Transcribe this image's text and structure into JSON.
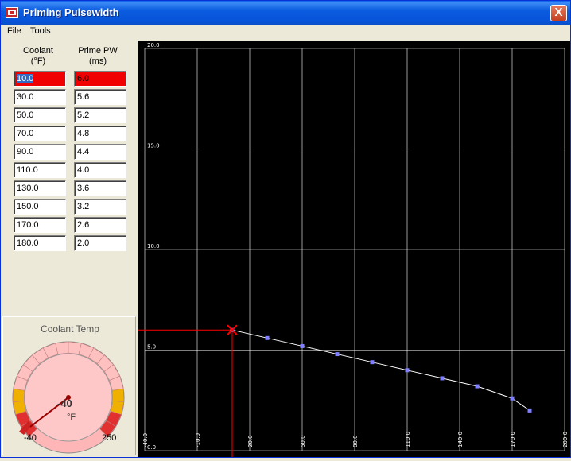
{
  "window": {
    "title": "Priming Pulsewidth",
    "close_label": "X"
  },
  "menu": {
    "items": [
      "File",
      "Tools"
    ]
  },
  "table": {
    "headers": {
      "coolant": [
        "Coolant",
        "(°F)"
      ],
      "prime": [
        "Prime PW",
        "(ms)"
      ]
    },
    "rows": [
      {
        "coolant": "10.0",
        "prime": "6.0"
      },
      {
        "coolant": "30.0",
        "prime": "5.6"
      },
      {
        "coolant": "50.0",
        "prime": "5.2"
      },
      {
        "coolant": "70.0",
        "prime": "4.8"
      },
      {
        "coolant": "90.0",
        "prime": "4.4"
      },
      {
        "coolant": "110.0",
        "prime": "4.0"
      },
      {
        "coolant": "130.0",
        "prime": "3.6"
      },
      {
        "coolant": "150.0",
        "prime": "3.2"
      },
      {
        "coolant": "170.0",
        "prime": "2.6"
      },
      {
        "coolant": "180.0",
        "prime": "2.0"
      }
    ],
    "selected_row": 0
  },
  "gauge": {
    "title": "Coolant Temp",
    "value": "-40",
    "unit": "°F",
    "min": "-40",
    "max": "250",
    "current": -40
  },
  "chart_data": {
    "type": "line",
    "x": [
      10,
      30,
      50,
      70,
      90,
      110,
      130,
      150,
      170,
      180
    ],
    "y": [
      6.0,
      5.6,
      5.2,
      4.8,
      4.4,
      4.0,
      3.6,
      3.2,
      2.6,
      2.0
    ],
    "xlim": [
      -40,
      200
    ],
    "ylim": [
      0,
      20
    ],
    "x_ticks": [
      "-40.0",
      "-10.0",
      "20.0",
      "50.0",
      "80.0",
      "110.0",
      "140.0",
      "170.0",
      "200.0"
    ],
    "y_ticks": [
      "0.0",
      "5.0",
      "10.0",
      "15.0",
      "20.0"
    ],
    "grid": true,
    "cursor": {
      "x": 10,
      "y": 6.0
    },
    "colors": {
      "background": "#000000",
      "grid": "#ffffff",
      "line": "#ffffff",
      "marker": "#7f7fff",
      "cursor": "#ff0000"
    }
  }
}
